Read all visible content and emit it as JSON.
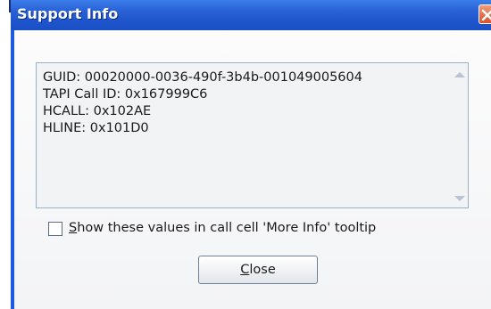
{
  "window": {
    "title": "Support Info"
  },
  "info": {
    "lines": [
      "GUID: 00020000-0036-490f-3b4b-001049005604",
      "TAPI Call ID: 0x167999C6",
      "HCALL: 0x102AE",
      "HLINE: 0x101D0"
    ]
  },
  "checkbox": {
    "mnemonic": "S",
    "rest": "how these values in call cell 'More Info' tooltip",
    "checked": false
  },
  "buttons": {
    "close_mnemonic": "C",
    "close_rest": "lose"
  },
  "icons": {
    "titlebar_close": "close-icon",
    "scroll_up": "arrow-up-icon",
    "scroll_down": "arrow-down-icon"
  },
  "colors": {
    "titlebar": "#245edb",
    "close": "#d8512a"
  }
}
